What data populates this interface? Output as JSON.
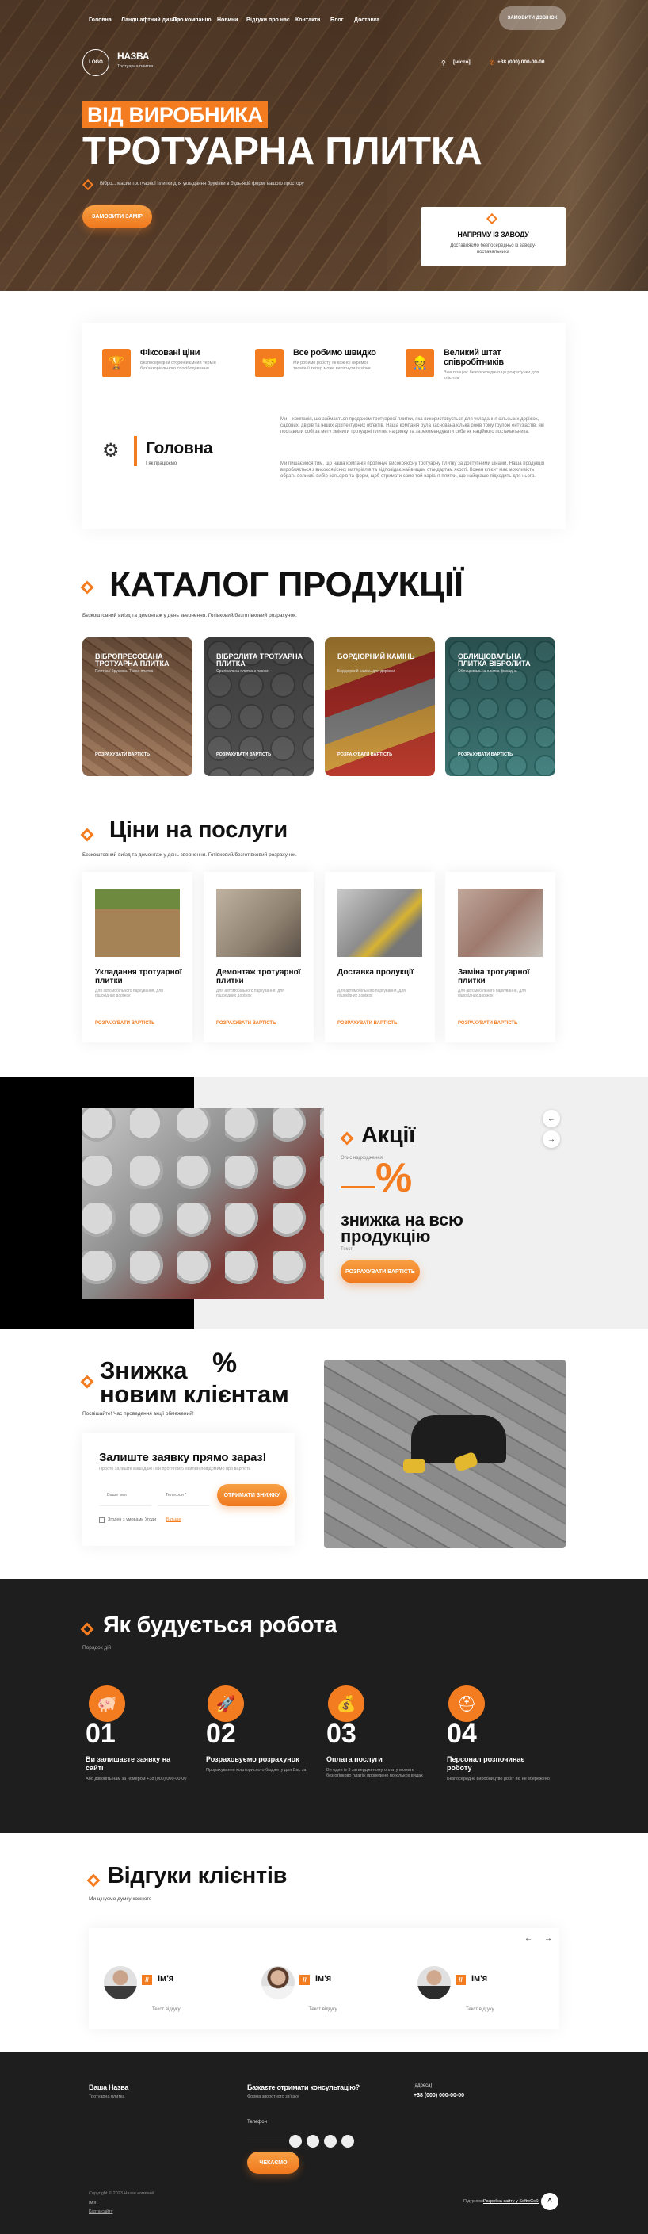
{
  "nav": {
    "items": [
      "Головна",
      "Ландшафтний дизайн",
      "Про компанію",
      "Новини",
      "Відгуки про нас",
      "Контакти",
      "Блог",
      "Доставка"
    ],
    "cta": "ЗАМОВИТИ ДЗВІНОК"
  },
  "brand": {
    "logo": "LOGO",
    "name": "НАЗВА",
    "tagline": "Тротуарна плитка",
    "address": "[місто]",
    "phone": "+38 (000) 000-00-00"
  },
  "hero": {
    "badge": "ВІД ВИРОБНИКА",
    "title": "ТРОТУАРНА ПЛИТКА",
    "subtitle": "Вібро... масив тротуарної плитки для укладання бруківки в будь-якій формі вашого простору",
    "button": "ЗАМОВИТИ ЗАМІР",
    "card_title": "НАПРЯМУ ІЗ ЗАВОДУ",
    "card_text": "Доставляємо безпосередньо із заводу-постачальника"
  },
  "features": [
    {
      "title": "Фіксовані ціни",
      "text": "Безпосередній стороній'ємний термін без'зазоріального спосібодавання"
    },
    {
      "title": "Все робимо швидко",
      "text": "Ми робимо роботу як кожної окремої тасманії тепер може витягнути із зірки"
    },
    {
      "title": "Великий штат співробітників",
      "text": "Вже працює безпосередньо ця розрахунки для клієнтів"
    }
  ],
  "about": {
    "title": "Головна",
    "subtitle": "І як працюємо",
    "p1": "Ми – компанія, що займається продажем тротуарної плитки, яка використовується для укладання сільських доріжок, садових, двірів та інших архітектурних об'єктів. Наша компанія була заснована кілька років тому групою ентузіастів, які поставили собі за мету змінити тротуарні плитки на ринку та зарекомендувати себе як надійного постачальника.",
    "p2": "Ми пишаємося тим, що наша компанія пропонує високоякісну тротуарну плитку за доступними цінами. Наша продукція виробляється з високоякісних матеріалів та відповідає найвищим стандартам якості. Кожен клієнт має можливість обрати великий вибір кольорів та форм, щоб отримати саме той варіант плитки, що найкраще підходить для нього."
  },
  "catalog": {
    "title": "КАТАЛОГ ПРОДУКЦІЇ",
    "subtitle": "Безкоштовний виїзд та демонтаж у день звернення. Готівковий/безготівковий розрахунок.",
    "cards": [
      {
        "title": "ВІБРОПРЕСОВАНА ТРОТУАРНА ПЛИТКА",
        "sub": "Плитка / бруківка. Ткана платка",
        "link": "РОЗРАХУВАТИ ВАРТІСТЬ"
      },
      {
        "title": "ВІБРОЛИТА ТРОТУАРНА ПЛИТКА",
        "sub": "Оригінальна плитка з пасом",
        "link": "РОЗРАХУВАТИ ВАРТІСТЬ"
      },
      {
        "title": "БОРДЮРНИЙ КАМІНЬ",
        "sub": "Бордюрний камінь для доріжки",
        "link": "РОЗРАХУВАТИ ВАРТІСТЬ"
      },
      {
        "title": "ОБЛИЦЮВАЛЬНА ПЛИТКА ВІБРОЛИТА",
        "sub": "Облицювальна плитка фасадна",
        "link": "РОЗРАХУВАТИ ВАРТІСТЬ"
      }
    ]
  },
  "services": {
    "title": "Ціни на послуги",
    "subtitle": "Безкоштовний виїзд та демонтаж у день звернення. Готівковий/безготівковий розрахунок.",
    "cards": [
      {
        "title": "Укладання тротуарної плитки",
        "text": "Для автомобільного паркування, для пішохідних доріжок",
        "link": "РОЗРАХУВАТИ ВАРТІСТЬ"
      },
      {
        "title": "Демонтаж тротуарної плитки",
        "text": "Для автомобільного паркування, для пішохідних доріжок",
        "link": "РОЗРАХУВАТИ ВАРТІСТЬ"
      },
      {
        "title": "Доставка продукції",
        "text": "Для автомобільного паркування, для пішохідних доріжок",
        "link": "РОЗРАХУВАТИ ВАРТІСТЬ"
      },
      {
        "title": "Заміна тротуарної плитки",
        "text": "Для автомобільного паркування, для пішохідних доріжок",
        "link": "РОЗРАХУВАТИ ВАРТІСТЬ"
      }
    ]
  },
  "promo": {
    "title": "Акції",
    "subtitle": "Опис надходження",
    "percent": "%",
    "headline": "знижка на всю продукцію",
    "small": "Текст",
    "button": "РОЗРАХУВАТИ ВАРТІСТЬ",
    "prev": "←",
    "next": "→"
  },
  "discount": {
    "title_line1": "Знижка",
    "percent": "%",
    "title_line2": "новим клієнтам",
    "subtitle": "Поспішайте! Час проведення акції обмежений!",
    "form_title": "Залиште заявку прямо зараз!",
    "form_text": "Просто залиште ваші дані і ми протягом 5 хвилин повідомимо про вартість",
    "name_placeholder": "Ваше ім'я",
    "phone_placeholder": "Телефон *",
    "button": "ОТРИМАТИ ЗНИЖКУ",
    "consent": "Згоден з умовами Угоди",
    "consent_link": "Більше"
  },
  "process": {
    "title": "Як будується робота",
    "subtitle": "Порядок дій",
    "steps": [
      {
        "num": "01",
        "title": "Ви залишаєте заявку на сайті",
        "text": "Або дзвоніть нам за номером +38 (000) 000-00-00"
      },
      {
        "num": "02",
        "title": "Розраховуємо розрахунок",
        "text": "Прорахування кошторисного бюджету для Вас за"
      },
      {
        "num": "03",
        "title": "Оплата послуги",
        "text": "Ви один із 3 затвердженому оплату можете безготівково платіж проведено по кількох видах"
      },
      {
        "num": "04",
        "title": "Персонал розпочинає роботу",
        "text": "Безпосереднє виробництво робіт які не збережено"
      }
    ]
  },
  "reviews": {
    "title": "Відгуки клієнтів",
    "subtitle": "Ми цінуємо думку кожного",
    "prev": "←",
    "next": "→",
    "items": [
      {
        "quote": "//",
        "name": "Ім'я",
        "text": "Текст відгуку"
      },
      {
        "quote": "//",
        "name": "Ім'я",
        "text": "Текст відгуку"
      },
      {
        "quote": "//",
        "name": "Ім'я",
        "text": "Текст відгуку"
      }
    ]
  },
  "footer": {
    "name": "Ваша Назва",
    "name_sub": "Тротуарна плитка",
    "consult_title": "Бажаєте отримати консультацію?",
    "consult_sub": "Форма зворотного зв'язку",
    "phone_label": "Телефон",
    "button": "ЧЕКАЄМО",
    "address": "[адреса]",
    "phone": "+38 (000) 000-00-00",
    "copyright": "Copyright © 2023 Назва компанії",
    "link1": "Ім'я",
    "link2": "Карта сайту",
    "dev_text": "Підтримка",
    "dev_link": "Розробка сайту у SoftwCcSt",
    "up": "^"
  },
  "colors": {
    "accent": "#f47c20",
    "dark": "#1e1e1e"
  }
}
